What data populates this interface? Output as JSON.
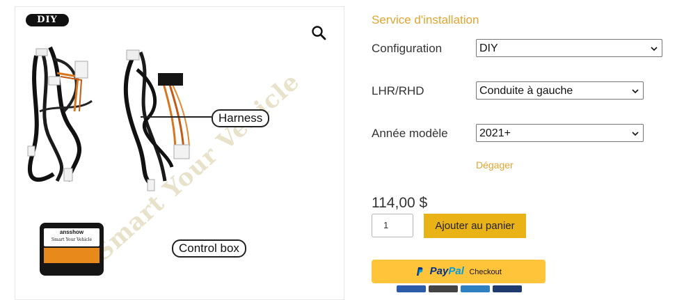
{
  "product_image": {
    "badge": "DIY",
    "harness_label": "Harness",
    "control_box_label": "Control box",
    "watermark": "Smart Your Vehicle",
    "box_brand": "ansshow",
    "box_tagline": "Smart Your Vehicle"
  },
  "options": {
    "service_label": "Service d'installation",
    "configuration": {
      "label": "Configuration",
      "value": "DIY"
    },
    "lhr_rhd": {
      "label": "LHR/RHD",
      "value": "Conduite à gauche"
    },
    "model_year": {
      "label": "Année modèle",
      "value": "2021+"
    },
    "clear_link": "Dégager"
  },
  "purchase": {
    "price": "114,00 $",
    "quantity": "1",
    "add_to_cart": "Ajouter au panier"
  },
  "paypal": {
    "pay": "Pay",
    "pal": "Pal",
    "checkout": "Checkout"
  },
  "colors": {
    "accent": "#e0a530",
    "cart_button": "#e9b216",
    "paypal_button": "#ffc439"
  }
}
